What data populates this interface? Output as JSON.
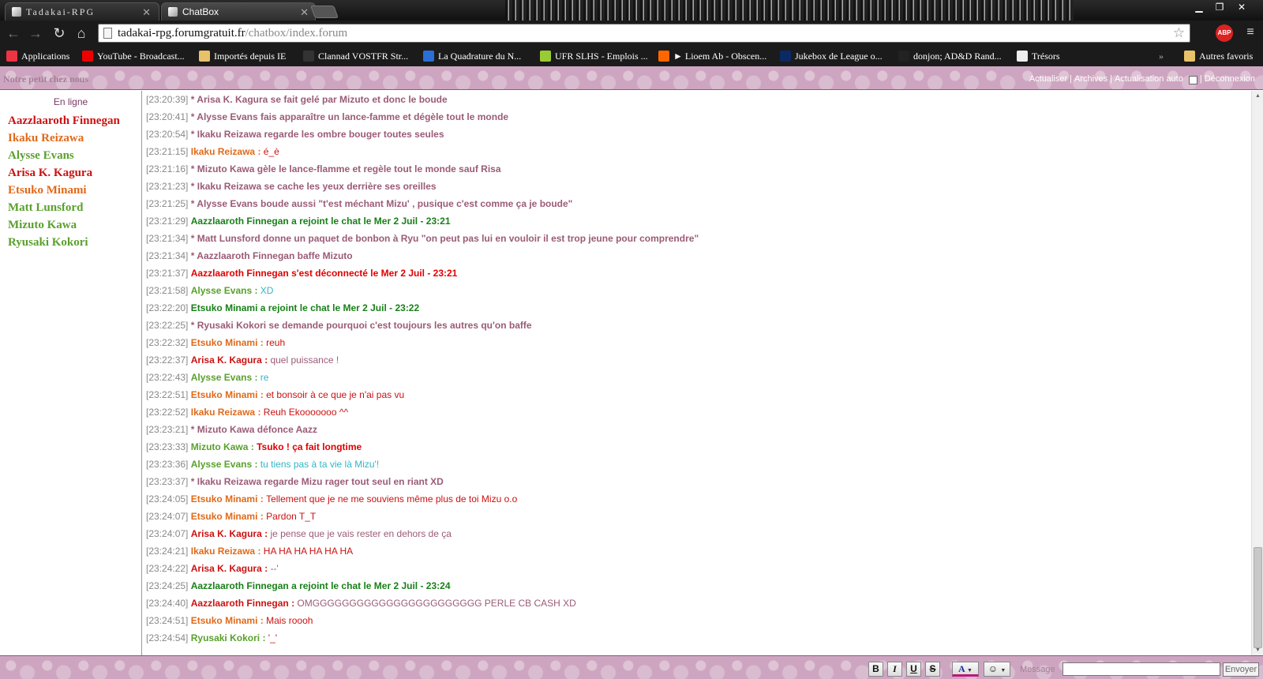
{
  "browser": {
    "tabs": [
      {
        "title": "Tadakai-RPG",
        "active": false
      },
      {
        "title": "ChatBox",
        "active": true
      }
    ],
    "url": {
      "host": "tadakai-rpg.forumgratuit.fr",
      "path": "/chatbox/index.forum"
    },
    "extension": "ABP",
    "bookmarks": [
      {
        "label": "Applications",
        "icon": "apps-grid-icon",
        "color": "#e34"
      },
      {
        "label": "YouTube - Broadcast...",
        "icon": "youtube-icon",
        "color": "#e00"
      },
      {
        "label": "Importés depuis IE",
        "icon": "folder-icon",
        "color": "#e8c26a"
      },
      {
        "label": "Clannad VOSTFR Str...",
        "icon": "site-icon",
        "color": "#333"
      },
      {
        "label": "La Quadrature du N...",
        "icon": "pi-icon",
        "color": "#2a6fd6"
      },
      {
        "label": "UFR SLHS - Emplois ...",
        "icon": "site-icon",
        "color": "#9c3"
      },
      {
        "label": "► Lioem Ab - Obscen...",
        "icon": "soundcloud-icon",
        "color": "#f60"
      },
      {
        "label": "Jukebox de League o...",
        "icon": "site-icon",
        "color": "#0a2a66"
      },
      {
        "label": "donjon; AD&D Rand...",
        "icon": "site-icon",
        "color": "#222"
      },
      {
        "label": "Trésors",
        "icon": "page-icon",
        "color": "#eee"
      }
    ],
    "overflow": "»",
    "other_bookmarks": "Autres favoris"
  },
  "chat": {
    "title": "Notre petit chez nous",
    "header_links": [
      "Actualiser",
      "Archives",
      "Actualisation auto"
    ],
    "auto_refresh_checked": "✓",
    "logout": "Déconnexion",
    "online_header": "En ligne",
    "online_users": [
      {
        "name": "Aazzlaaroth Finnegan",
        "color": "#cc1111"
      },
      {
        "name": "Ikaku Reizawa",
        "color": "#e06a1a"
      },
      {
        "name": "Alysse Evans",
        "color": "#5aa02c"
      },
      {
        "name": "Arisa K. Kagura",
        "color": "#cc1111"
      },
      {
        "name": "Etsuko Minami",
        "color": "#e06a1a"
      },
      {
        "name": "Matt Lunsford",
        "color": "#5aa02c"
      },
      {
        "name": "Mizuto Kawa",
        "color": "#5aa02c"
      },
      {
        "name": "Ryusaki Kokori",
        "color": "#5aa02c"
      }
    ],
    "messages": [
      {
        "time": "[23:20:39]",
        "type": "action",
        "text": "* Arisa K. Kagura se fait gelé par Mizuto et donc le boude"
      },
      {
        "time": "[23:20:41]",
        "type": "action",
        "text": "* Alysse Evans fais apparaître un lance-famme et dégèle tout le monde"
      },
      {
        "time": "[23:20:54]",
        "type": "action",
        "text": "* Ikaku Reizawa regarde les ombre bouger toutes seules"
      },
      {
        "time": "[23:21:15]",
        "type": "say",
        "name": "Ikaku Reizawa",
        "name_color": "#e06a1a",
        "text": "é_è",
        "text_color": "#cc1111",
        "bold": false
      },
      {
        "time": "[23:21:16]",
        "type": "action",
        "text": "* Mizuto Kawa gèle le lance-flamme et regèle tout le monde sauf Risa"
      },
      {
        "time": "[23:21:23]",
        "type": "action",
        "text": "* Ikaku Reizawa se cache les yeux derrière ses oreilles"
      },
      {
        "time": "[23:21:25]",
        "type": "action",
        "text": "* Alysse Evans boude aussi \"t'est méchant Mizu' , pusique c'est comme ça je boude\""
      },
      {
        "time": "[23:21:29]",
        "type": "join",
        "text": "Aazzlaaroth Finnegan a rejoint le chat le Mer 2 Juil - 23:21"
      },
      {
        "time": "[23:21:34]",
        "type": "action",
        "text": "* Matt Lunsford donne un paquet de bonbon à Ryu \"on peut pas lui en vouloir il est trop jeune pour comprendre\""
      },
      {
        "time": "[23:21:34]",
        "type": "action",
        "text": "* Aazzlaaroth Finnegan baffe Mizuto"
      },
      {
        "time": "[23:21:37]",
        "type": "leave",
        "text": "Aazzlaaroth Finnegan s'est déconnecté le Mer 2 Juil - 23:21"
      },
      {
        "time": "[23:21:58]",
        "type": "say",
        "name": "Alysse Evans",
        "name_color": "#5aa02c",
        "text": "XD",
        "text_color": "#33b5c4",
        "bold": false
      },
      {
        "time": "[23:22:20]",
        "type": "join",
        "text": "Etsuko Minami a rejoint le chat le Mer 2 Juil - 23:22"
      },
      {
        "time": "[23:22:25]",
        "type": "action",
        "text": "* Ryusaki Kokori se demande pourquoi c'est toujours les autres qu'on baffe"
      },
      {
        "time": "[23:22:32]",
        "type": "say",
        "name": "Etsuko Minami",
        "name_color": "#e06a1a",
        "text": "reuh",
        "text_color": "#cc1111",
        "bold": false
      },
      {
        "time": "[23:22:37]",
        "type": "say",
        "name": "Arisa K. Kagura",
        "name_color": "#cc1111",
        "text": "quel puissance !",
        "text_color": "#9b5b76",
        "bold": false
      },
      {
        "time": "[23:22:43]",
        "type": "say",
        "name": "Alysse Evans",
        "name_color": "#5aa02c",
        "text": "re",
        "text_color": "#33b5c4",
        "bold": false
      },
      {
        "time": "[23:22:51]",
        "type": "say",
        "name": "Etsuko Minami",
        "name_color": "#e06a1a",
        "text": "et bonsoir à ce que je n'ai pas vu",
        "text_color": "#cc1111",
        "bold": false
      },
      {
        "time": "[23:22:52]",
        "type": "say",
        "name": "Ikaku Reizawa",
        "name_color": "#e06a1a",
        "text": "Reuh Ekooooooo ^^",
        "text_color": "#cc1111",
        "bold": false
      },
      {
        "time": "[23:23:21]",
        "type": "action",
        "text": "* Mizuto Kawa défonce Aazz"
      },
      {
        "time": "[23:23:33]",
        "type": "say",
        "name": "Mizuto Kawa",
        "name_color": "#5aa02c",
        "text": "Tsuko ! ça fait longtime",
        "text_color": "#e00000",
        "bold": true
      },
      {
        "time": "[23:23:36]",
        "type": "say",
        "name": "Alysse Evans",
        "name_color": "#5aa02c",
        "text": "tu tiens pas à ta vie là Mizu'!",
        "text_color": "#33b5c4",
        "bold": false
      },
      {
        "time": "[23:23:37]",
        "type": "action",
        "text": "* Ikaku Reizawa regarde Mizu rager tout seul en riant XD"
      },
      {
        "time": "[23:24:05]",
        "type": "say",
        "name": "Etsuko Minami",
        "name_color": "#e06a1a",
        "text": "Tellement que je ne me souviens même plus de toi Mizu o.o",
        "text_color": "#cc1111",
        "bold": false
      },
      {
        "time": "[23:24:07]",
        "type": "say",
        "name": "Etsuko Minami",
        "name_color": "#e06a1a",
        "text": "Pardon T_T",
        "text_color": "#cc1111",
        "bold": false
      },
      {
        "time": "[23:24:07]",
        "type": "say",
        "name": "Arisa K. Kagura",
        "name_color": "#cc1111",
        "text": "je pense que je vais rester en dehors de ça",
        "text_color": "#9b5b76",
        "bold": false
      },
      {
        "time": "[23:24:21]",
        "type": "say",
        "name": "Ikaku Reizawa",
        "name_color": "#e06a1a",
        "text": "HA HA HA HA HA HA",
        "text_color": "#cc1111",
        "bold": false
      },
      {
        "time": "[23:24:22]",
        "type": "say",
        "name": "Arisa K. Kagura",
        "name_color": "#cc1111",
        "text": "--'",
        "text_color": "#9b5b76",
        "bold": false
      },
      {
        "time": "[23:24:25]",
        "type": "join",
        "text": "Aazzlaaroth Finnegan a rejoint le chat le Mer 2 Juil - 23:24"
      },
      {
        "time": "[23:24:40]",
        "type": "say",
        "name": "Aazzlaaroth Finnegan",
        "name_color": "#cc1111",
        "text": "OMGGGGGGGGGGGGGGGGGGGGGGG PERLE CB CASH XD",
        "text_color": "#9b5b76",
        "bold": false
      },
      {
        "time": "[23:24:51]",
        "type": "say",
        "name": "Etsuko Minami",
        "name_color": "#e06a1a",
        "text": "Mais roooh",
        "text_color": "#cc1111",
        "bold": false
      },
      {
        "time": "[23:24:54]",
        "type": "say",
        "name": "Ryusaki Kokori",
        "name_color": "#5aa02c",
        "text": "'_'",
        "text_color": "#cc1111",
        "bold": false
      }
    ],
    "format_buttons": {
      "bold": "B",
      "italic": "I",
      "underline": "U",
      "strike": "S",
      "color": "A",
      "emoji": "☺"
    },
    "message_label": "Message",
    "message_value": "",
    "send_label": "Envoyer"
  }
}
